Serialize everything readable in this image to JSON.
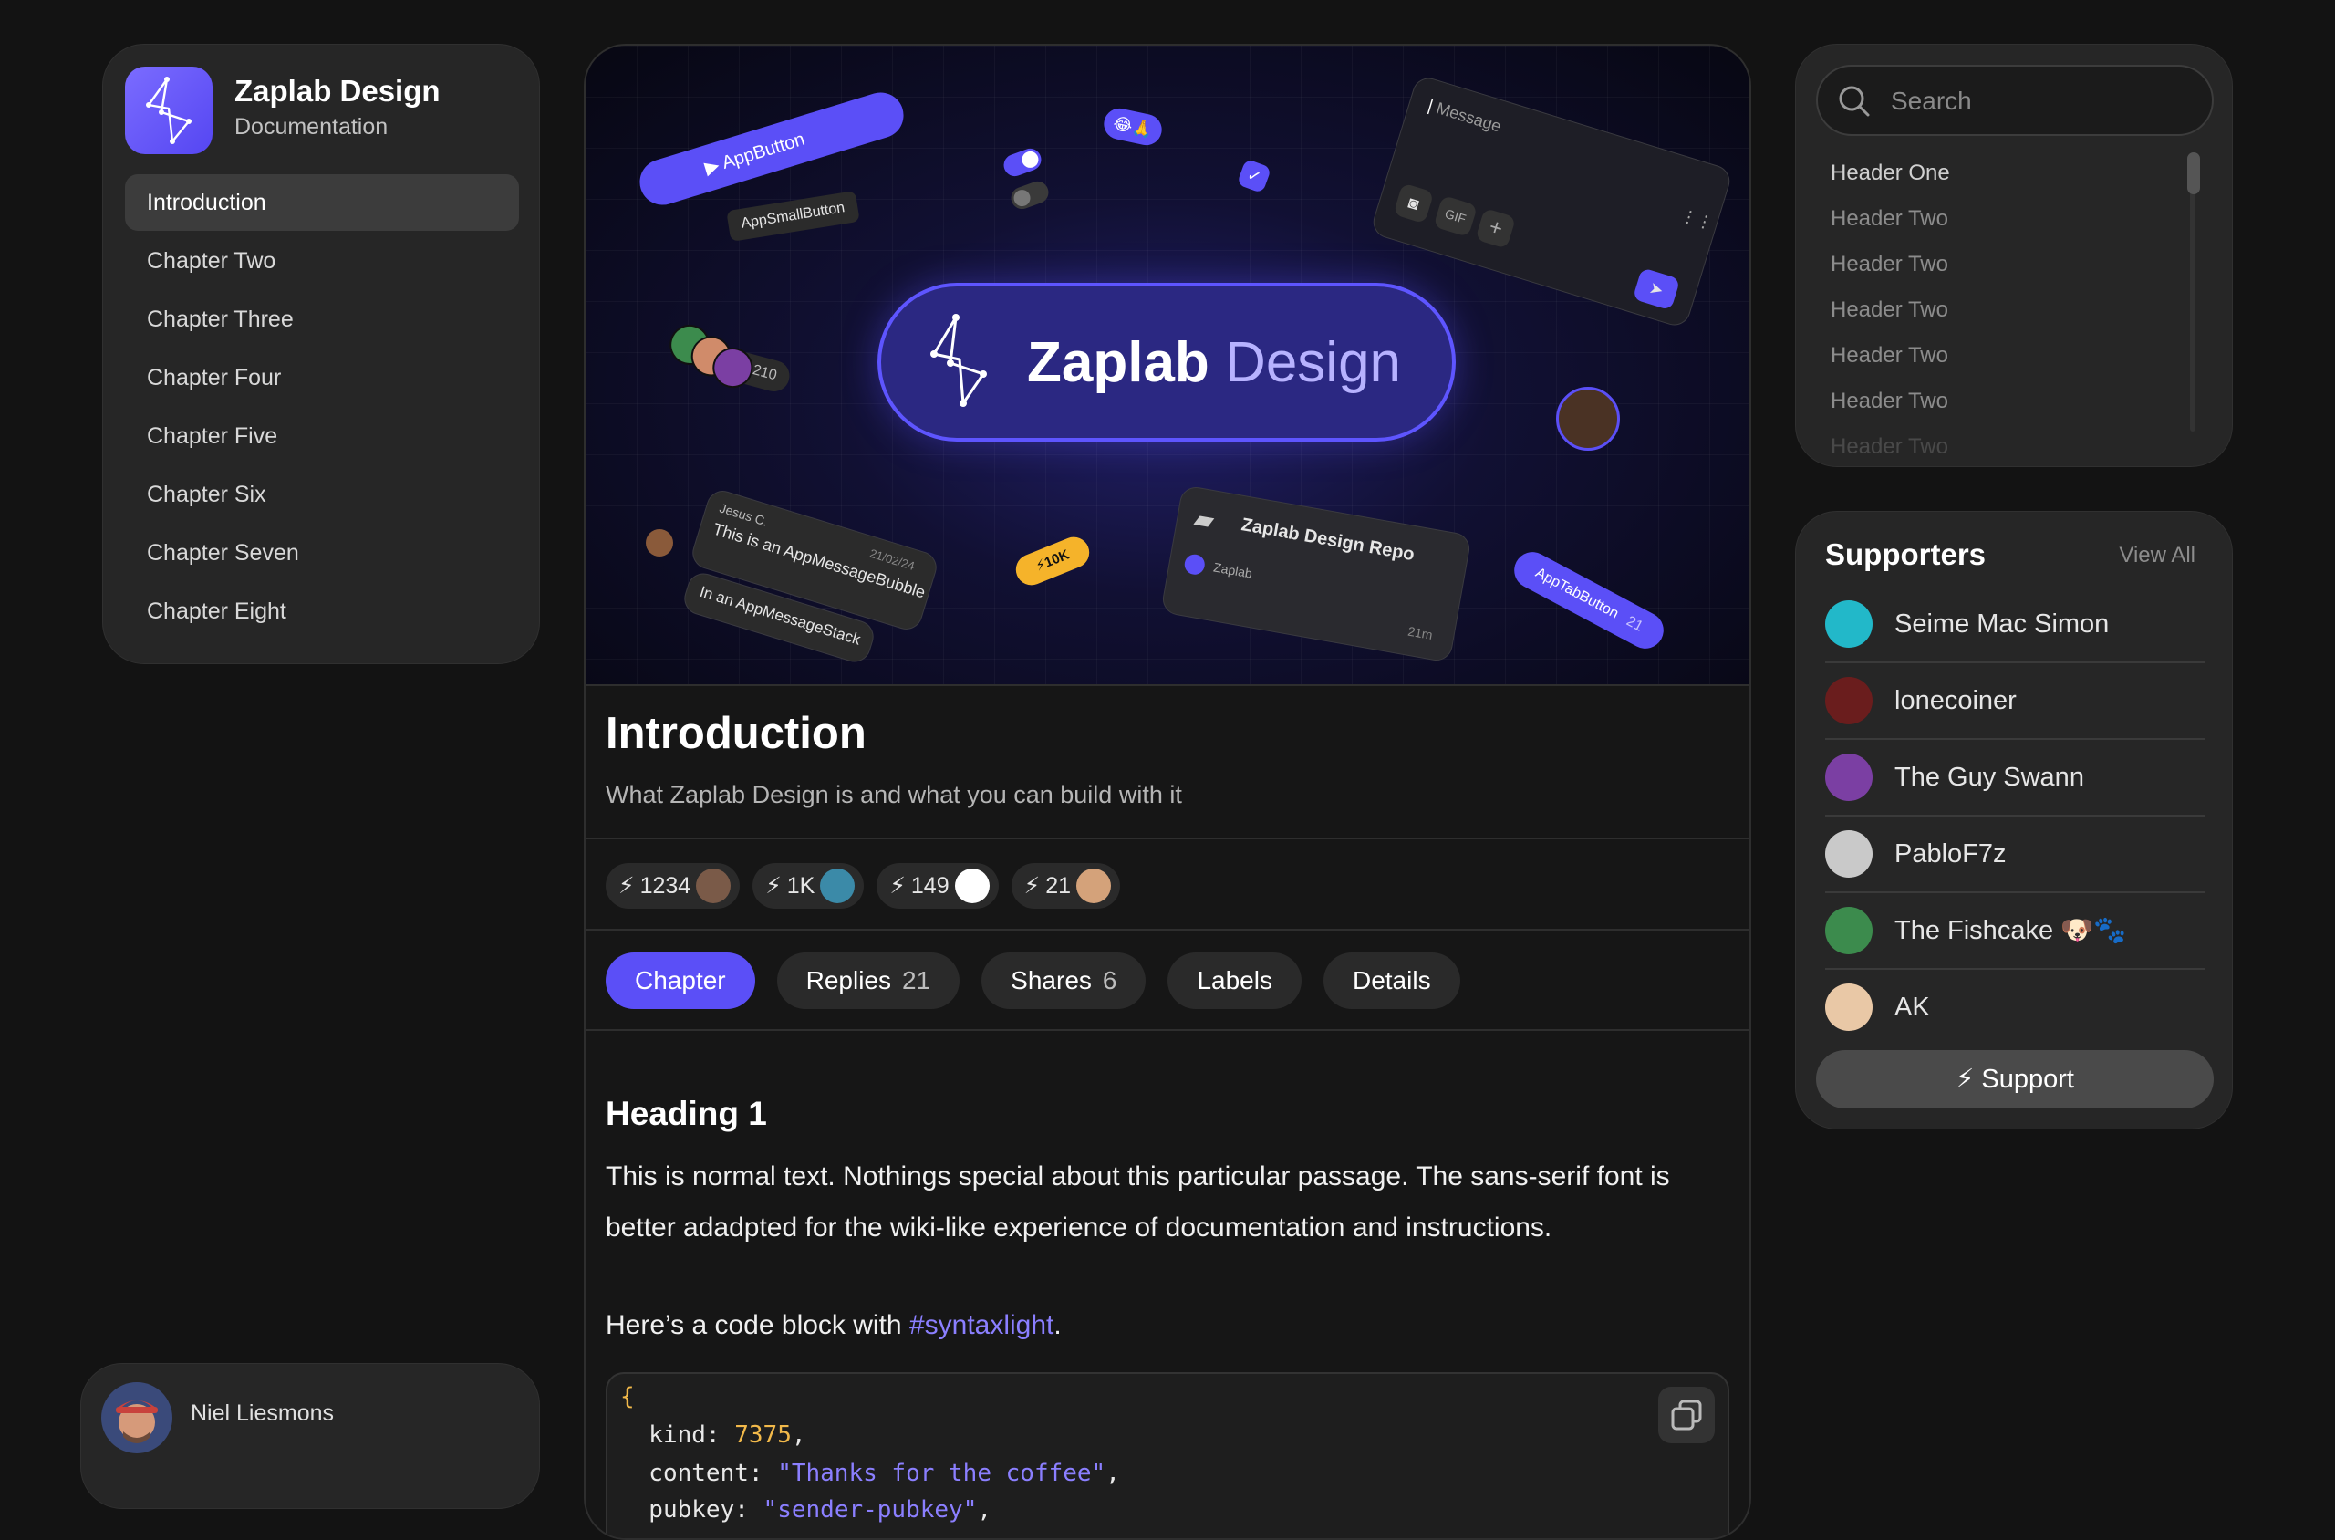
{
  "brand": {
    "title": "Zaplab Design",
    "subtitle": "Documentation",
    "accent": "#5b4ff7"
  },
  "nav": {
    "items": [
      {
        "label": "Introduction",
        "active": true
      },
      {
        "label": "Chapter Two"
      },
      {
        "label": "Chapter Three"
      },
      {
        "label": "Chapter Four"
      },
      {
        "label": "Chapter Five"
      },
      {
        "label": "Chapter Six"
      },
      {
        "label": "Chapter Seven"
      },
      {
        "label": "Chapter Eight"
      }
    ]
  },
  "user": {
    "name": "Niel Liesmons"
  },
  "hero": {
    "title_bold": "Zaplab",
    "title_light": "Design",
    "chips": {
      "app_button": "AppButton",
      "app_small_button": "AppSmallButton",
      "avatars_count": "210",
      "message_placeholder": "Message",
      "gif": "GIF",
      "bubble_author": "Jesus C.",
      "bubble_date": "21/02/24",
      "bubble_text": "This is an AppMessageBubble",
      "stack_text": "In an AppMessageStack",
      "zap_10k": "10K",
      "repo_title": "Zaplab Design Repo",
      "repo_owner": "Zaplab",
      "repo_time": "21m",
      "tab_button": "AppTabButton",
      "tab_button_count": "21"
    }
  },
  "article": {
    "title": "Introduction",
    "subtitle": "What Zaplab Design is and what you can build with it",
    "zaps": [
      {
        "amount": "1234",
        "avatar_color": "#7a5a48"
      },
      {
        "amount": "1K",
        "avatar_color": "#3b8aa8"
      },
      {
        "amount": "149",
        "avatar_color": "#ffffff"
      },
      {
        "amount": "21",
        "avatar_color": "#d4a27a"
      }
    ],
    "tabs": [
      {
        "label": "Chapter",
        "count": "",
        "active": true
      },
      {
        "label": "Replies",
        "count": "21"
      },
      {
        "label": "Shares",
        "count": "6"
      },
      {
        "label": "Labels",
        "count": ""
      },
      {
        "label": "Details",
        "count": ""
      }
    ],
    "heading": "Heading 1",
    "body": "This is normal text. Nothings special about this particular passage. The sans-serif font is better adadpted for the wiki-like experience of documentation and instructions.",
    "code_intro_before": "Here’s a code block with ",
    "code_intro_hashtag": "#syntaxlight",
    "code_intro_after": ".",
    "code": {
      "open_brace": "{",
      "line1_key": "  kind: ",
      "line1_val": "7375",
      "line1_end": ",",
      "line2_key": "  content: ",
      "line2_val": "\"Thanks for the coffee\"",
      "line2_end": ",",
      "line3_key": "  pubkey: ",
      "line3_val": "\"sender-pubkey\"",
      "line3_end": ","
    }
  },
  "toc": {
    "search_placeholder": "Search",
    "items": [
      "Header One",
      "Header Two",
      "Header Two",
      "Header Two",
      "Header Two",
      "Header Two",
      "Header Two"
    ]
  },
  "supporters": {
    "title": "Supporters",
    "view_all": "View All",
    "items": [
      {
        "name": "Seime Mac Simon",
        "color": "#22b8c9"
      },
      {
        "name": "lonecoiner",
        "color": "#6a1d1d"
      },
      {
        "name": "The Guy Swann",
        "color": "#7b3fa3"
      },
      {
        "name": "PabloF7z",
        "color": "#c9c9c9"
      },
      {
        "name": "The Fishcake 🐶🐾",
        "color": "#3c8b4d"
      },
      {
        "name": "AK",
        "color": "#e9c8a6"
      }
    ],
    "support_label": "Support"
  }
}
